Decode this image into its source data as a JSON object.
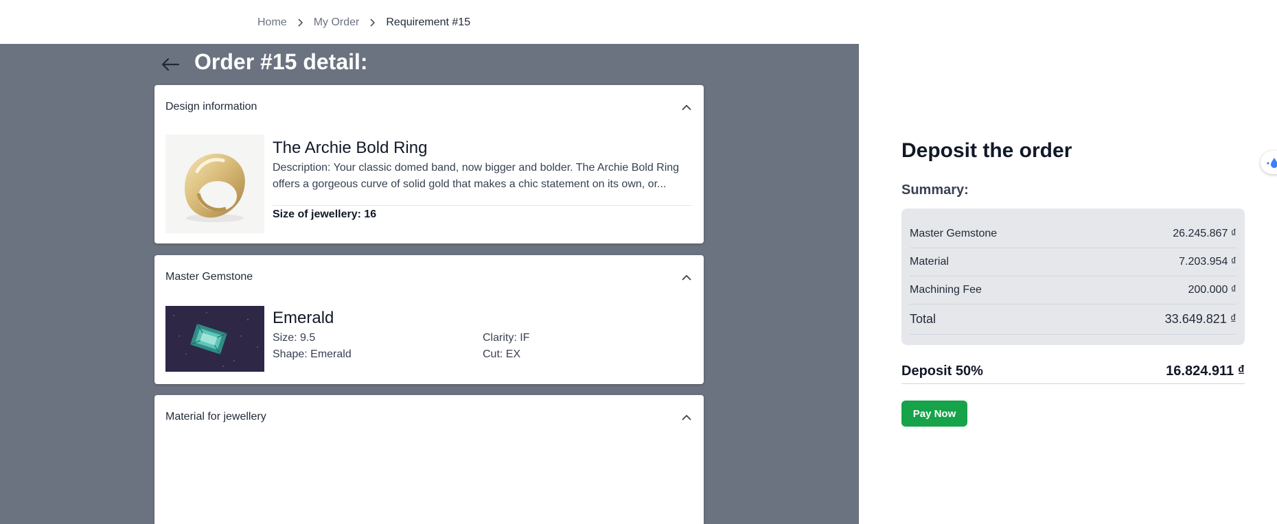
{
  "breadcrumb": {
    "items": [
      "Home",
      "My Order",
      "Requirement #15"
    ]
  },
  "page": {
    "title": "Order #15 detail:",
    "back_icon": "arrow-left-icon"
  },
  "design_panel": {
    "header": "Design information",
    "name": "The Archie Bold Ring",
    "description": "Description: Your classic domed band, now bigger and bolder. The Archie Bold Ring offers a gorgeous curve of solid gold that makes a chic statement on its own, or...",
    "size": "Size of jewellery: 16"
  },
  "gem_panel": {
    "header": "Master Gemstone",
    "name": "Emerald",
    "size": "Size: 9.5",
    "shape": "Shape: Emerald",
    "clarity": "Clarity: IF",
    "cut": "Cut: EX"
  },
  "material_panel": {
    "header": "Material for jewellery"
  },
  "deposit": {
    "title": "Deposit the order",
    "summary_label": "Summary:",
    "rows": [
      {
        "label": "Master Gemstone",
        "value": "26.245.867 ₫"
      },
      {
        "label": "Material",
        "value": "7.203.954 ₫"
      },
      {
        "label": "Machining Fee",
        "value": "200.000 ₫"
      },
      {
        "label": "Total",
        "value": "33.649.821 ₫"
      }
    ],
    "deposit_label": "Deposit 50%",
    "deposit_value": "16.824.911 ₫",
    "pay_button": "Pay Now"
  },
  "colors": {
    "left_background": "#6b7280",
    "summary_background": "#e5e7eb",
    "pay_button": "#16a34a"
  }
}
